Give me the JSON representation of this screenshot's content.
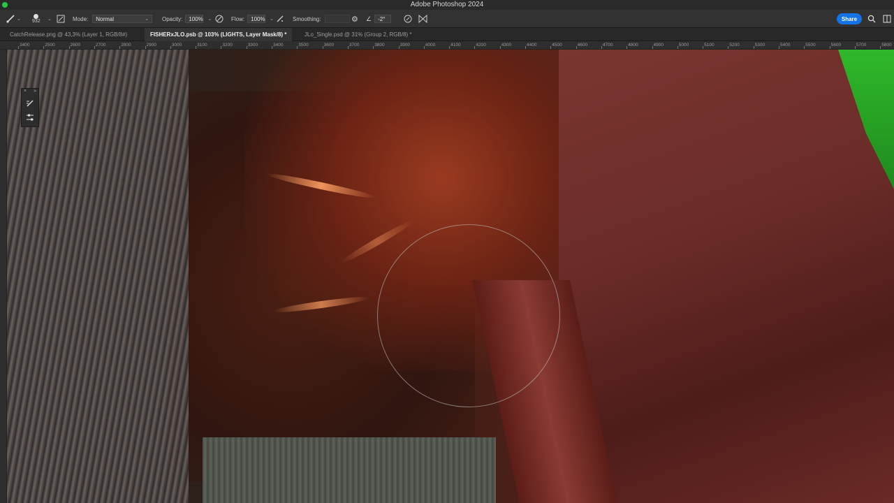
{
  "window": {
    "title": "Adobe Photoshop 2024"
  },
  "options_bar": {
    "brush_size": "932",
    "mode_label": "Mode:",
    "mode_value": "Normal",
    "opacity_label": "Opacity:",
    "opacity_value": "100%",
    "flow_label": "Flow:",
    "flow_value": "100%",
    "smoothing_label": "Smoothing:",
    "smoothing_value": "",
    "angle_value": "-2°",
    "share_label": "Share"
  },
  "tabs": [
    {
      "label": "CatchRelease.png @ 43,3% (Layer 1, RGB/8#)",
      "active": false
    },
    {
      "label": "FISHERxJLO.psb @ 103% (LIGHTS, Layer Mask/8) *",
      "active": true
    },
    {
      "label": "JLo_Single.psd @ 31% (Group 2, RGB/8) *",
      "active": false
    }
  ],
  "ruler": {
    "labels": [
      "3400",
      "2500",
      "2600",
      "2700",
      "2800",
      "2900",
      "3000",
      "3100",
      "3200",
      "3300",
      "3400",
      "3500",
      "3600",
      "3700",
      "3800",
      "3900",
      "4000",
      "4100",
      "4200",
      "4300",
      "4400",
      "4500",
      "4600",
      "4700",
      "4800",
      "4900",
      "5000",
      "5100",
      "5200",
      "5300",
      "5400",
      "5500",
      "5600",
      "5700",
      "5800"
    ]
  },
  "icons": {
    "brush_tool": "brush-icon",
    "search": "search-icon",
    "workspace": "panel-icon"
  }
}
